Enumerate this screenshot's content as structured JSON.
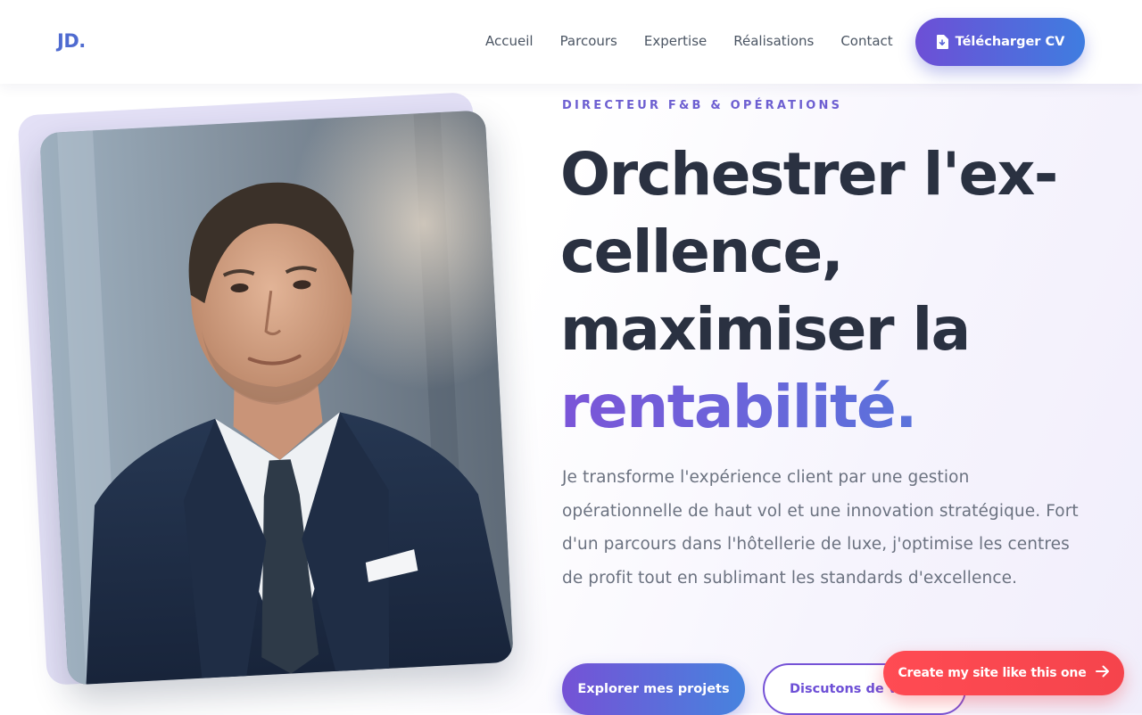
{
  "brand": {
    "logo": "JD."
  },
  "nav": {
    "links": [
      "Accueil",
      "Parcours",
      "Expertise",
      "Réalisations",
      "Contact"
    ],
    "cv_button": {
      "label": "Télécharger CV",
      "icon": "file-download-icon"
    }
  },
  "hero": {
    "eyebrow": "DIRECTEUR F&B & OPÉRATIONS",
    "headline_lines": [
      "Orchestrer l'ex-",
      "cellence,",
      "maximiser la"
    ],
    "headline_accent": "rentabilité.",
    "intro": "Je transforme l'expérience client par une gestion opérationnelle de haut vol et une innovation stratégique. Fort d'un parcours dans l'hôtellerie de luxe, j'optimise les centres de profit tout en sublimant les standards d'excellence.",
    "primary_button": "Explorer mes projets",
    "secondary_button": "Discutons de vos projets",
    "portrait_icon": "portrait-photo"
  },
  "floating": {
    "create_site": "Create my site like this one",
    "icon": "arrow-right-icon"
  },
  "colors": {
    "accent_start": "#7552d6",
    "accent_end": "#4783de",
    "heading": "#2a3141",
    "body_text": "#6b7280",
    "cta_red": "#f5444c"
  }
}
